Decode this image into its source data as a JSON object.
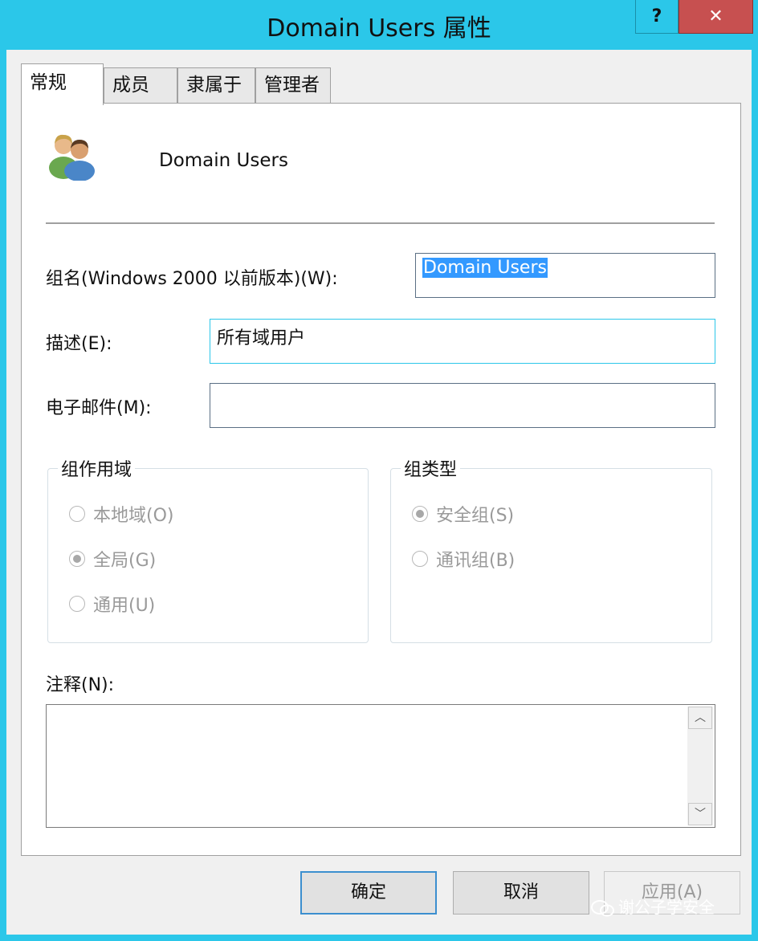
{
  "window": {
    "title": "Domain Users 属性",
    "help_label": "?",
    "close_label": "✕"
  },
  "tabs": [
    {
      "label": "常规"
    },
    {
      "label": "成员"
    },
    {
      "label": "隶属于"
    },
    {
      "label": "管理者"
    }
  ],
  "general": {
    "group_name": "Domain Users",
    "sam_label": "组名(Windows 2000 以前版本)(W):",
    "sam_value": "Domain Users",
    "desc_label": "描述(E):",
    "desc_value": "所有域用户",
    "email_label": "电子邮件(M):",
    "email_value": "",
    "scope": {
      "title": "组作用域",
      "options": [
        {
          "label": "本地域(O)",
          "checked": false
        },
        {
          "label": "全局(G)",
          "checked": true
        },
        {
          "label": "通用(U)",
          "checked": false
        }
      ]
    },
    "type": {
      "title": "组类型",
      "options": [
        {
          "label": "安全组(S)",
          "checked": true
        },
        {
          "label": "通讯组(B)",
          "checked": false
        }
      ]
    },
    "notes_label": "注释(N):",
    "notes_value": ""
  },
  "buttons": {
    "ok": "确定",
    "cancel": "取消",
    "apply": "应用(A)"
  },
  "watermark": "谢公子学安全",
  "colors": {
    "titlebar": "#2bc7e9",
    "close": "#c75050",
    "selection": "#3399ff"
  }
}
